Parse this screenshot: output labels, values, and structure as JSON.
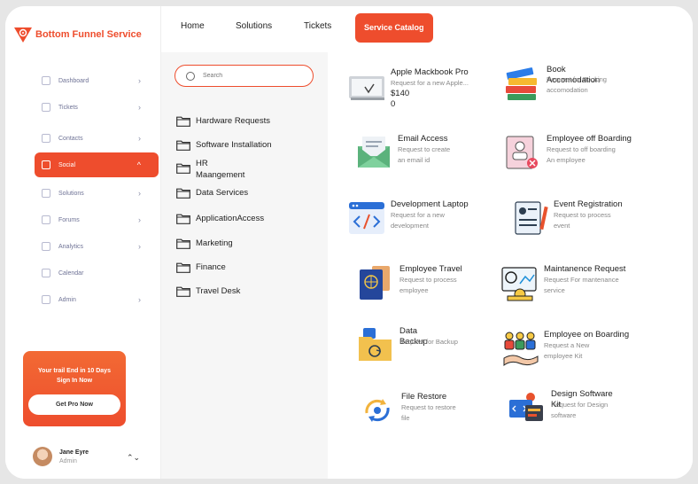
{
  "brand": {
    "name": "Bottom Funnel Service",
    "accent": "#ee4d2d"
  },
  "sidebar": {
    "items": [
      {
        "label": "Dashboard",
        "icon": "dashboard-icon",
        "chevron": "›"
      },
      {
        "label": "Tickets",
        "icon": "ticket-icon",
        "chevron": "›"
      },
      {
        "label": "Contacts",
        "icon": "contacts-icon",
        "chevron": "›"
      },
      {
        "label": "Social",
        "icon": "social-icon",
        "chevron": "^",
        "active": true
      },
      {
        "label": "Solutions",
        "icon": "solutions-icon",
        "chevron": "›"
      },
      {
        "label": "Forums",
        "icon": "forums-icon",
        "chevron": "›"
      },
      {
        "label": "Analytics",
        "icon": "analytics-icon",
        "chevron": "›"
      },
      {
        "label": "Calendar",
        "icon": "calendar-icon",
        "chevron": ""
      },
      {
        "label": "Admin",
        "icon": "admin-icon",
        "chevron": "›"
      }
    ],
    "promo": {
      "line1": "Your trail End in 10 Days",
      "line2": "Sign In Now",
      "button": "Get Pro Now"
    },
    "user": {
      "name": "Jane Eyre",
      "role": "Admin",
      "toggle": "⌃⌄"
    }
  },
  "topnav": {
    "tabs": [
      "Home",
      "Solutions",
      "Tickets",
      "Service Catalog"
    ]
  },
  "search": {
    "placeholder": "Search"
  },
  "categories": [
    "Hardware Requests",
    "Software Installation",
    "HR\nMaangement",
    "Data Services",
    "ApplicationAccess",
    "Marketing",
    "Finance",
    "Travel Desk"
  ],
  "services": [
    {
      "title": "Apple Mackbook Pro",
      "desc": "Request for a new Apple...",
      "price": "$140\n0",
      "icon": "laptop-icon"
    },
    {
      "title": "Book\nAccomodation",
      "desc": "Request for Booking\naccomodation",
      "icon": "books-icon"
    },
    {
      "title": "Email Access",
      "desc": "Request to create\nan email id",
      "icon": "email-icon"
    },
    {
      "title": "Employee off Boarding",
      "desc": "Request to off boarding\nAn employee",
      "icon": "offboarding-icon"
    },
    {
      "title": "Development Laptop",
      "desc": "Request for a new\ndevelopment",
      "icon": "code-window-icon"
    },
    {
      "title": "Event Registration",
      "desc": "Request to process\nevent",
      "icon": "registration-icon"
    },
    {
      "title": "Employee Travel",
      "desc": "Request to process\nemployee",
      "icon": "passport-icon"
    },
    {
      "title": "Maintanence Request",
      "desc": "Request For mantenance\nservice",
      "icon": "maintenance-icon"
    },
    {
      "title": "Data\nBackup",
      "desc": "Request for Backup",
      "icon": "backup-folder-icon"
    },
    {
      "title": "Employee on Boarding",
      "desc": "Request a New\nemployee Kit",
      "icon": "onboarding-icon"
    },
    {
      "title": "File Restore",
      "desc": "Request to restore\nfile",
      "icon": "restore-icon"
    },
    {
      "title": "Design Software\nKit",
      "desc": "Request for Design\nsoftware",
      "icon": "design-kit-icon"
    }
  ]
}
